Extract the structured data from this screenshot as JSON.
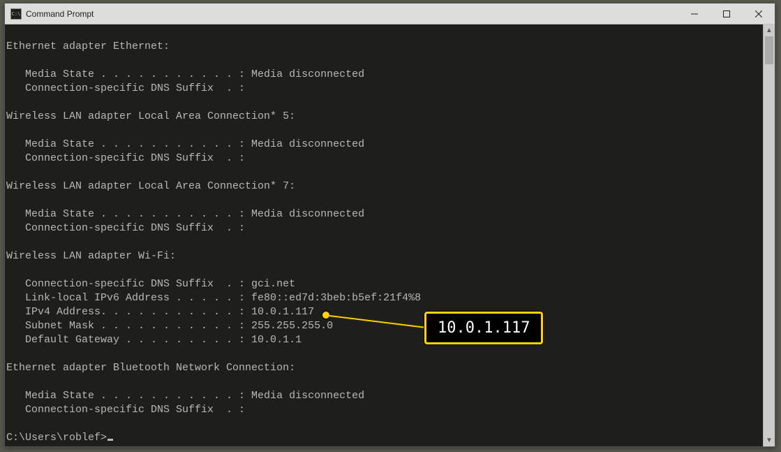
{
  "window": {
    "title": "Command Prompt",
    "icon_label": "cmd-icon"
  },
  "annotation": {
    "value": "10.0.1.117"
  },
  "console_lines": [
    "",
    "Ethernet adapter Ethernet:",
    "",
    "   Media State . . . . . . . . . . . : Media disconnected",
    "   Connection-specific DNS Suffix  . :",
    "",
    "Wireless LAN adapter Local Area Connection* 5:",
    "",
    "   Media State . . . . . . . . . . . : Media disconnected",
    "   Connection-specific DNS Suffix  . :",
    "",
    "Wireless LAN adapter Local Area Connection* 7:",
    "",
    "   Media State . . . . . . . . . . . : Media disconnected",
    "   Connection-specific DNS Suffix  . :",
    "",
    "Wireless LAN adapter Wi-Fi:",
    "",
    "   Connection-specific DNS Suffix  . : gci.net",
    "   Link-local IPv6 Address . . . . . : fe80::ed7d:3beb:b5ef:21f4%8",
    "   IPv4 Address. . . . . . . . . . . : 10.0.1.117",
    "   Subnet Mask . . . . . . . . . . . : 255.255.255.0",
    "   Default Gateway . . . . . . . . . : 10.0.1.1",
    "",
    "Ethernet adapter Bluetooth Network Connection:",
    "",
    "   Media State . . . . . . . . . . . : Media disconnected",
    "   Connection-specific DNS Suffix  . :",
    ""
  ],
  "prompt": "C:\\Users\\roblef>"
}
